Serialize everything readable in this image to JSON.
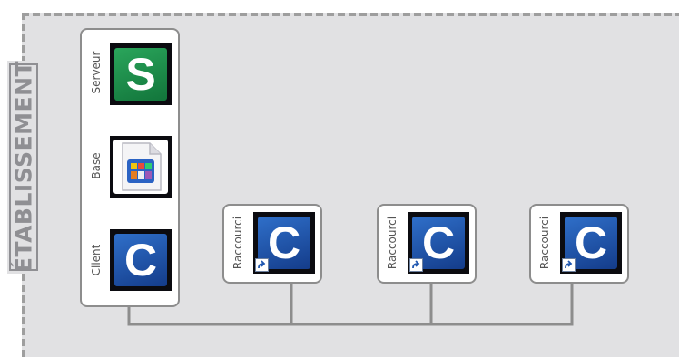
{
  "zone": {
    "label": "ÉTABLISSEMENT"
  },
  "main_station": {
    "items": [
      {
        "label": "Serveur",
        "icon": "server-app-icon",
        "glyph": "S"
      },
      {
        "label": "Base",
        "icon": "database-file-icon"
      },
      {
        "label": "Client",
        "icon": "client-app-icon",
        "glyph": "C"
      }
    ]
  },
  "shortcuts": [
    {
      "label": "Raccourci",
      "icon": "client-shortcut-icon",
      "glyph": "C"
    },
    {
      "label": "Raccourci",
      "icon": "client-shortcut-icon",
      "glyph": "C"
    },
    {
      "label": "Raccourci",
      "icon": "client-shortcut-icon",
      "glyph": "C"
    }
  ],
  "colors": {
    "zone_background": "#e1e1e3",
    "zone_border": "#9e9e9e",
    "server_green": "#1e8c4a",
    "client_blue": "#1f57b0",
    "connector": "#8d8d8d"
  }
}
